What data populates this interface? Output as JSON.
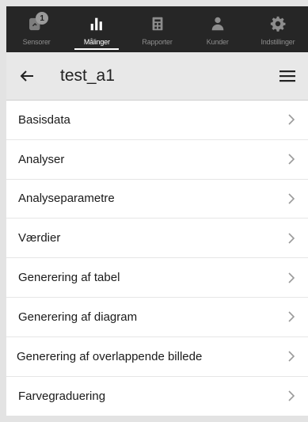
{
  "tabs": [
    {
      "label": "Sensorer",
      "icon": "sensor-icon",
      "badge": "1",
      "active": false
    },
    {
      "label": "Målinger",
      "icon": "bar-chart-icon",
      "active": true
    },
    {
      "label": "Rapporter",
      "icon": "report-icon",
      "active": false
    },
    {
      "label": "Kunder",
      "icon": "customers-icon",
      "active": false
    },
    {
      "label": "Indstillinger",
      "icon": "gear-icon",
      "active": false
    }
  ],
  "header": {
    "title": "test_a1",
    "back_icon": "back-arrow-icon",
    "menu_icon": "hamburger-menu-icon"
  },
  "menu_items": [
    {
      "label": "Basisdata"
    },
    {
      "label": "Analyser"
    },
    {
      "label": "Analyseparametre"
    },
    {
      "label": "Værdier"
    },
    {
      "label": "Generering af tabel"
    },
    {
      "label": "Generering af diagram"
    },
    {
      "label": "Generering af overlappende billede"
    },
    {
      "label": "Farvegraduering"
    }
  ],
  "colors": {
    "tabbar_bg": "#262626",
    "tab_active": "#ffffff",
    "tab_inactive": "#8d8d8d",
    "header_bg": "#e8e8e8",
    "page_bg": "#e3e3e3"
  }
}
